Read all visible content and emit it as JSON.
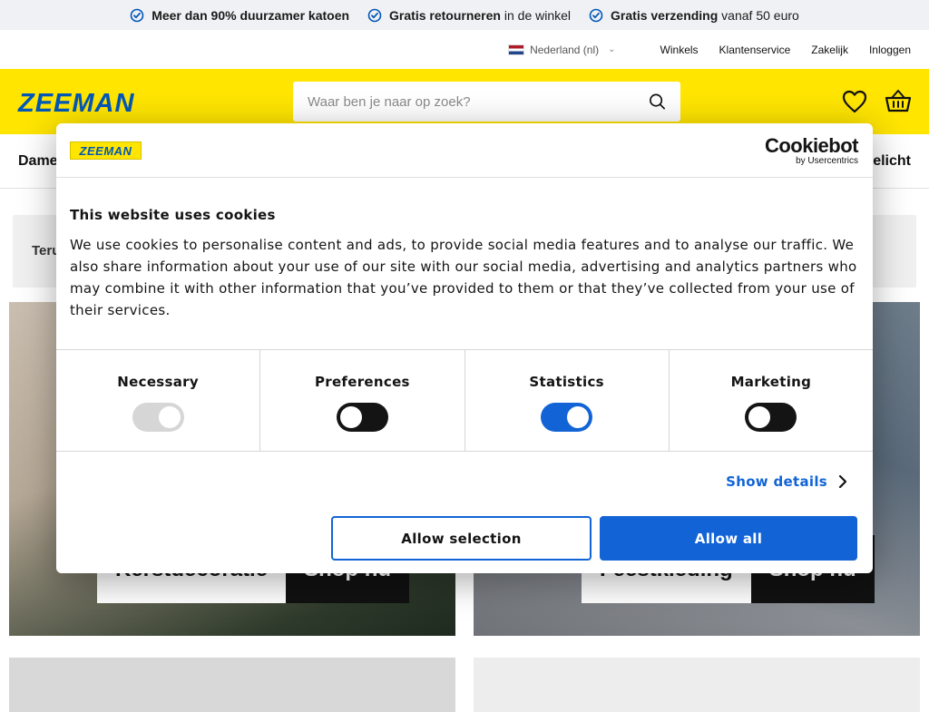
{
  "usp": [
    {
      "bold": "Meer dan 90% duurzamer katoen",
      "rest": ""
    },
    {
      "bold": "Gratis retourneren",
      "rest": " in de winkel"
    },
    {
      "bold": "Gratis verzending",
      "rest": " vanaf 50 euro"
    }
  ],
  "util": {
    "country": "Nederland (nl)",
    "links": [
      "Winkels",
      "Klantenservice",
      "Zakelijk",
      "Inloggen"
    ]
  },
  "header": {
    "logo": "ZEEMAN",
    "search_placeholder": "Waar ben je naar op zoek?"
  },
  "nav": {
    "left_label": "Dame",
    "right_label": "elicht"
  },
  "page": {
    "back_label": "Teru",
    "tile1": {
      "label": "Kerstdecoratie",
      "shop": "Shop nu"
    },
    "tile2": {
      "label": "Feestkleding",
      "shop": "Shop nu"
    }
  },
  "cookie": {
    "logo": "ZEEMAN",
    "brand": "Cookiebot",
    "brand_sub": "by Usercentrics",
    "title": "This website uses cookies",
    "text": "We use cookies to personalise content and ads, to provide social media features and to analyse our traffic. We also share information about your use of our site with our social media, advertising and analytics partners who may combine it with other information that you’ve provided to them or that they’ve collected from your use of their services.",
    "toggles": [
      {
        "label": "Necessary",
        "state": "disabled"
      },
      {
        "label": "Preferences",
        "state": "off"
      },
      {
        "label": "Statistics",
        "state": "on"
      },
      {
        "label": "Marketing",
        "state": "off"
      }
    ],
    "show_details": "Show details",
    "allow_selection": "Allow selection",
    "allow_all": "Allow all"
  },
  "colors": {
    "brand_yellow": "#ffe500",
    "brand_blue": "#0057b8",
    "cookiebot_blue": "#1264d6"
  }
}
